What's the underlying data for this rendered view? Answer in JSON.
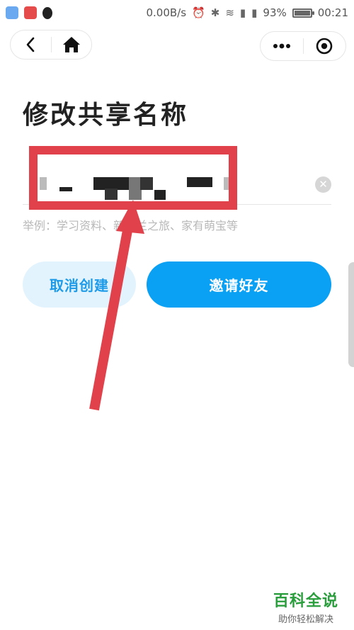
{
  "status_bar": {
    "net_speed": "0.00B/s",
    "battery_percent_label": "93%",
    "battery_level": 0.93,
    "time": "00:21",
    "app_icons": [
      "shield-app-icon",
      "netease-music-icon",
      "qq-icon"
    ],
    "system_icons": [
      "alarm-icon",
      "bluetooth-icon",
      "wifi-icon",
      "signal-icon",
      "signal-icon-2"
    ]
  },
  "page": {
    "title": "修改共享名称",
    "name_input": {
      "value": "",
      "placeholder": ""
    },
    "hint": "举例：学习资料、新西兰之旅、家有萌宝等",
    "cancel_label": "取消创建",
    "invite_label": "邀请好友"
  },
  "watermark": {
    "main": "百科全说",
    "sub": "助你轻松解决"
  },
  "colors": {
    "accent": "#0aa1f4",
    "accent_light": "#e2f3fe",
    "annotation": "#e0414a",
    "watermark": "#2a9d3c"
  }
}
